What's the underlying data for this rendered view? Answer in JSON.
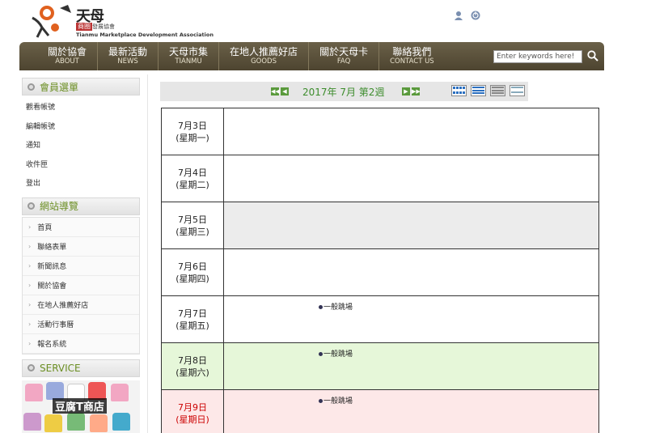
{
  "header": {
    "logo": {
      "cn_name": "天母",
      "badge": "商圈",
      "sub": "發展協會",
      "en_name": "Tianmu Marketplace Development Association"
    },
    "icons": [
      "user-icon",
      "power-icon"
    ]
  },
  "nav": {
    "items": [
      {
        "cn": "關於協會",
        "en": "ABOUT"
      },
      {
        "cn": "最新活動",
        "en": "NEWS"
      },
      {
        "cn": "天母市集",
        "en": "TIANMU"
      },
      {
        "cn": "在地人推薦好店",
        "en": "GOODS"
      },
      {
        "cn": "關於天母卡",
        "en": "FAQ"
      },
      {
        "cn": "聯絡我們",
        "en": "CONTACT US"
      }
    ],
    "search": {
      "value": "Enter keywords here!"
    }
  },
  "sidebar": {
    "member_title": "會員選單",
    "member_items": [
      "觀看帳號",
      "編輯帳號",
      "通知",
      "收件匣",
      "登出"
    ],
    "sitemap_title": "網站導覽",
    "sitemap_items": [
      "首頁",
      "聯絡表單",
      "新聞訊息",
      "關於協會",
      "在地人推薦好店",
      "活動行事曆",
      "報名系統"
    ],
    "service_title": "SERVICE",
    "service_banner": "豆腐T商店"
  },
  "calendar": {
    "title": "2017年 7月 第2週",
    "view_buttons": [
      "month-view-icon",
      "week-view-icon",
      "day-view-icon",
      "list-view-icon"
    ],
    "days": [
      {
        "date": "7月3日",
        "weekday": "(星期一)",
        "style": "normal",
        "events": []
      },
      {
        "date": "7月4日",
        "weekday": "(星期二)",
        "style": "normal",
        "events": []
      },
      {
        "date": "7月5日",
        "weekday": "(星期三)",
        "style": "gray",
        "events": []
      },
      {
        "date": "7月6日",
        "weekday": "(星期四)",
        "style": "normal",
        "events": []
      },
      {
        "date": "7月7日",
        "weekday": "(星期五)",
        "style": "normal",
        "events": [
          "一般跳場"
        ]
      },
      {
        "date": "7月8日",
        "weekday": "(星期六)",
        "style": "green",
        "events": [
          "一般跳場"
        ]
      },
      {
        "date": "7月9日",
        "weekday": "(星期日)",
        "style": "pink",
        "events": [
          "一般跳場"
        ]
      }
    ]
  },
  "colors": {
    "nav_bg": "#5b5139",
    "accent_green": "#3c8c2c",
    "saturday_bg": "#e6f7d9",
    "sunday_bg": "#fde8e8"
  }
}
